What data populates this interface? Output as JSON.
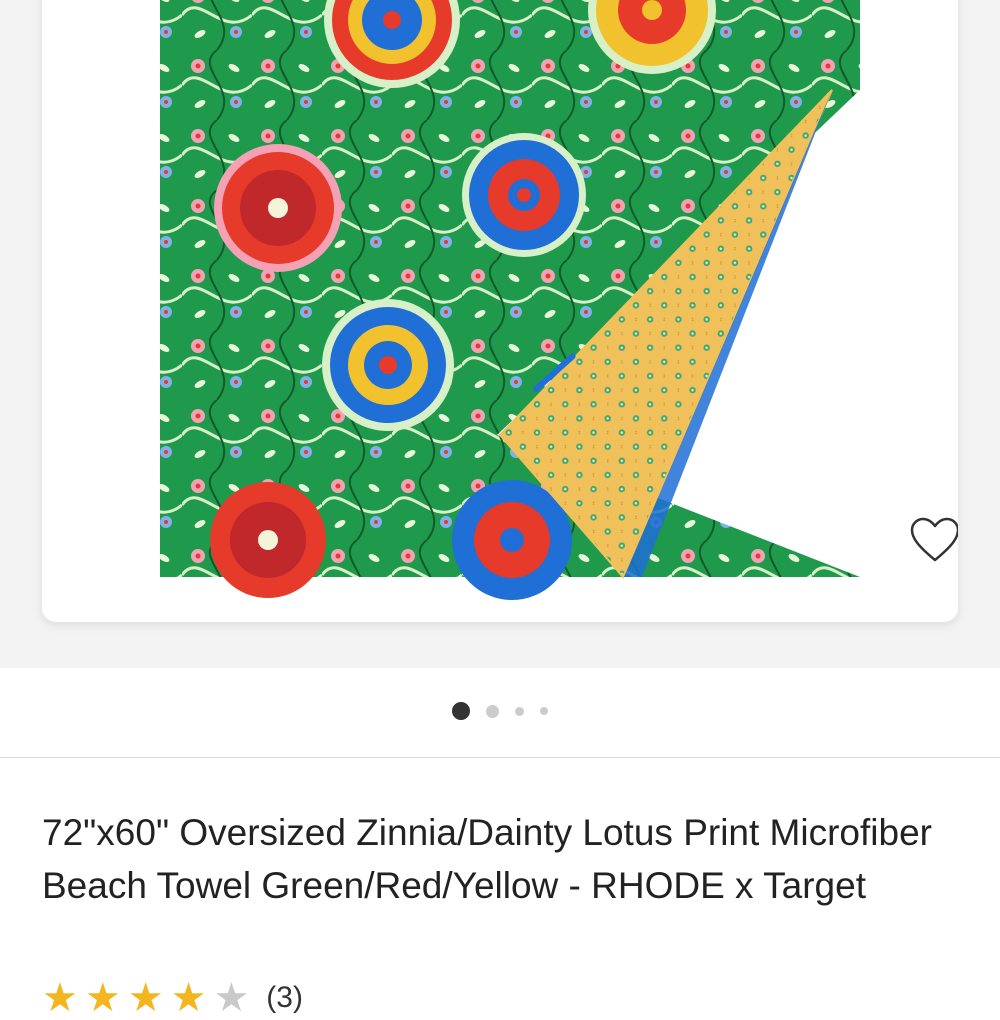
{
  "product": {
    "title": "72\"x60\" Oversized Zinnia/Dainty Lotus Print Microfiber Beach Towel Green/Red/Yellow - RHODE x Target",
    "rating": 4,
    "rating_max": 5,
    "review_count_label": "(3)"
  },
  "gallery": {
    "image_count": 4,
    "active_index": 0,
    "favorite_icon": "heart-outline-icon"
  },
  "colors": {
    "towel_green": "#1f9a4c",
    "towel_red": "#e63a2a",
    "towel_blue": "#1f6fd6",
    "towel_yellow": "#f2c12e",
    "towel_back_yellow": "#f0c15a",
    "dot_active": "#333333",
    "dot_inactive": "#cccccc",
    "star_filled": "#f3b61f",
    "star_empty": "#c9c9c9",
    "text_dark": "#222222"
  }
}
